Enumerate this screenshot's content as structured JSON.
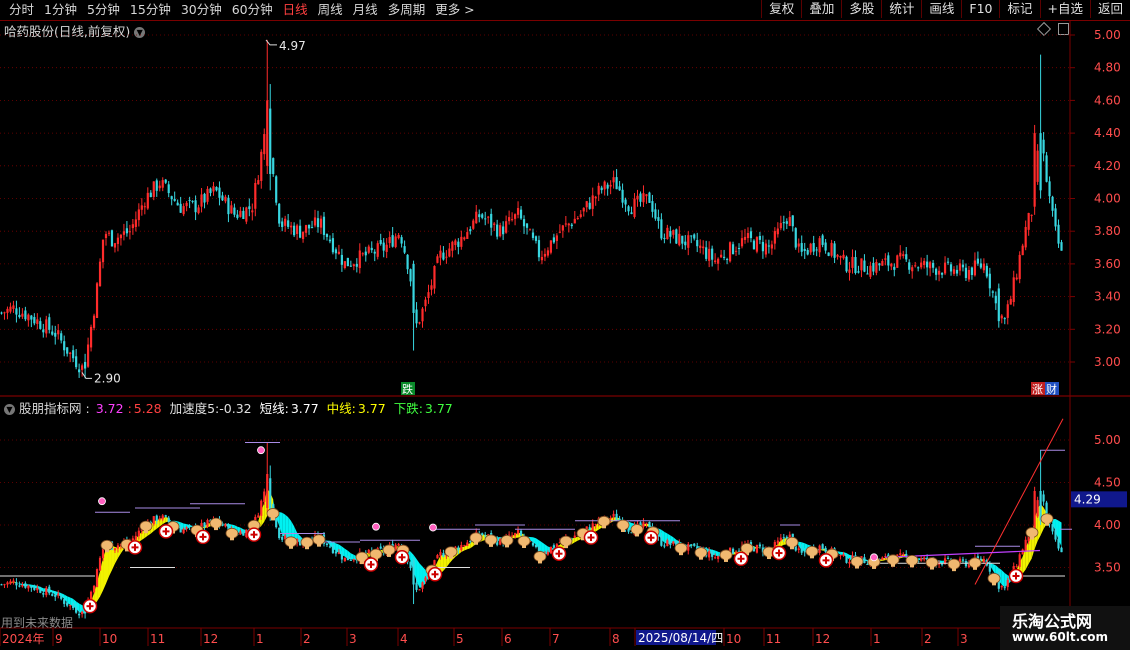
{
  "toolbar": {
    "periods": [
      "分时",
      "1分钟",
      "5分钟",
      "15分钟",
      "30分钟",
      "60分钟",
      "日线",
      "周线",
      "月线",
      "多周期",
      "更多 >"
    ],
    "active_period": "日线",
    "buttons": [
      "复权",
      "叠加",
      "多股",
      "统计",
      "画线",
      "F10",
      "标记",
      "+自选",
      "返回"
    ]
  },
  "main_chart": {
    "title": "哈药股份(日线,前复权)",
    "y_ticks": [
      "5.00",
      "4.80",
      "4.60",
      "4.40",
      "4.20",
      "4.00",
      "3.80",
      "3.60",
      "3.40",
      "3.20",
      "3.00"
    ],
    "high_label": "4.97",
    "low_label": "2.90",
    "event_labels": {
      "die": "跌",
      "zhang": "涨",
      "cai": "财"
    }
  },
  "indicator": {
    "name": "股朋指标网",
    "v1": "3.72",
    "v2": "5.28",
    "accel_label": "加速度5:",
    "accel_value": "-0.32",
    "short_label": "短线:",
    "short_value": "3.77",
    "mid_label": "中线:",
    "mid_value": "3.77",
    "down_label": "下跌:",
    "down_value": "3.77",
    "y_ticks": [
      "5.00",
      "4.50",
      "4.00",
      "3.50"
    ],
    "current_value": "4.29",
    "future_note": "用到未来数据"
  },
  "time_axis": {
    "labels": [
      "2024年",
      "9",
      "10",
      "11",
      "12",
      "1",
      "2",
      "3",
      "4",
      "5",
      "6",
      "7",
      "8",
      "2025/08/14/四",
      "10",
      "11",
      "12",
      "1",
      "2",
      "3"
    ]
  },
  "chart_data": {
    "type": "candlestick",
    "title": "哈药股份(日线,前复权)",
    "ylim": [
      2.85,
      5.05
    ],
    "highest": 4.97,
    "lowest": 2.9,
    "close_path": [
      {
        "x": "2024-07",
        "y": 3.3
      },
      {
        "x": "2024-08",
        "y": 3.05
      },
      {
        "x": "2024-09",
        "y": 2.95
      },
      {
        "x": "2024-10",
        "y": 3.95
      },
      {
        "x": "2024-11",
        "y": 4.05
      },
      {
        "x": "2024-12",
        "y": 4.0
      },
      {
        "x": "2025-01",
        "y": 4.2
      },
      {
        "x": "2025-02",
        "y": 3.85
      },
      {
        "x": "2025-03",
        "y": 3.65
      },
      {
        "x": "2025-04",
        "y": 3.35
      },
      {
        "x": "2025-05",
        "y": 3.8
      },
      {
        "x": "2025-06",
        "y": 3.7
      },
      {
        "x": "2025-07",
        "y": 3.95
      },
      {
        "x": "2025-08",
        "y": 4.05
      },
      {
        "x": "2025-09",
        "y": 3.75
      },
      {
        "x": "2025-10",
        "y": 3.7
      },
      {
        "x": "2025-11",
        "y": 3.8
      },
      {
        "x": "2025-12",
        "y": 3.6
      },
      {
        "x": "2026-01",
        "y": 3.58
      },
      {
        "x": "2026-02",
        "y": 3.55
      },
      {
        "x": "2026-03",
        "y": 4.2
      },
      {
        "x": "2026-03b",
        "y": 3.62
      }
    ]
  },
  "colors": {
    "up": "#ff2b2b",
    "down": "#38d6e0",
    "grid": "#7a0000",
    "axis_text": "#ff4d4d",
    "ma_yellow": "#ffff00",
    "ma_cyan": "#00ffff",
    "resistance": "#a98be6",
    "trend_red": "#ff3030",
    "trend_magenta": "#c040ff"
  },
  "watermark": {
    "line1": "乐淘公式网",
    "line2": "www.60lt.com"
  }
}
